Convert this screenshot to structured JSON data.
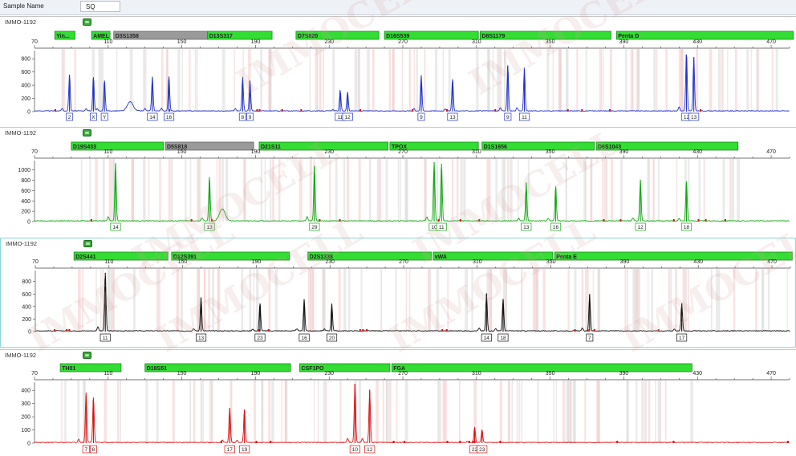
{
  "header": {
    "sample_name_label": "Sample Name",
    "sample_name_value": "SQ"
  },
  "watermark": {
    "text": "IMMOCELL",
    "color": "#d8a7a7"
  },
  "colors": {
    "blue": "#2233cc",
    "green": "#11aa11",
    "black": "#111111",
    "red": "#dd1111",
    "marker_fill": "#33dd33",
    "marker_gray": "#9a9a9a",
    "stutter": "#f3caca",
    "bin_gray": "#d9d9d9"
  },
  "chart_data": [
    {
      "type": "line",
      "panel_title": "IMMO-1192",
      "color": "blue",
      "xlim": [
        70,
        480
      ],
      "xticks": [
        70,
        110,
        150,
        190,
        230,
        270,
        310,
        350,
        390,
        430,
        470
      ],
      "ylim": [
        0,
        900
      ],
      "yticks": [
        0,
        200,
        400,
        600,
        800
      ],
      "markers": [
        {
          "label": "Yin...",
          "start": 81,
          "end": 92,
          "gray": false
        },
        {
          "label": "AMEL",
          "start": 101,
          "end": 111,
          "gray": false
        },
        {
          "label": "D3S1358",
          "start": 113,
          "end": 164,
          "gray": true
        },
        {
          "label": "D13S317",
          "start": 164,
          "end": 199,
          "gray": false
        },
        {
          "label": "D7S820",
          "start": 212,
          "end": 257,
          "gray": false
        },
        {
          "label": "D16S539",
          "start": 260,
          "end": 311,
          "gray": false
        },
        {
          "label": "D8S1179",
          "start": 312,
          "end": 383,
          "gray": false
        },
        {
          "label": "Penta D",
          "start": 386,
          "end": 482,
          "gray": false
        }
      ],
      "peaks": [
        {
          "x": 89,
          "h": 560,
          "label": "2"
        },
        {
          "x": 102,
          "h": 520,
          "label": "X"
        },
        {
          "x": 108,
          "h": 470,
          "label": "Y"
        },
        {
          "x": 134,
          "h": 520,
          "label": "14"
        },
        {
          "x": 143,
          "h": 530,
          "label": "16"
        },
        {
          "x": 183,
          "h": 490,
          "label": "8"
        },
        {
          "x": 187,
          "h": 470,
          "label": "9"
        },
        {
          "x": 236,
          "h": 300,
          "label": "11"
        },
        {
          "x": 240,
          "h": 290,
          "label": "12"
        },
        {
          "x": 280,
          "h": 540,
          "label": "9"
        },
        {
          "x": 297,
          "h": 490,
          "label": "13"
        },
        {
          "x": 327,
          "h": 700,
          "label": "9"
        },
        {
          "x": 336,
          "h": 660,
          "label": "11"
        },
        {
          "x": 424,
          "h": 860,
          "label": "12"
        },
        {
          "x": 428,
          "h": 820,
          "label": "13"
        }
      ],
      "minor_peaks": [
        {
          "x": 122,
          "h": 140
        }
      ]
    },
    {
      "type": "line",
      "panel_title": "IMMO-1192",
      "color": "green",
      "xlim": [
        70,
        480
      ],
      "xticks": [
        70,
        110,
        150,
        190,
        230,
        270,
        310,
        350,
        390,
        430,
        470
      ],
      "ylim": [
        0,
        1150
      ],
      "yticks": [
        0,
        200,
        400,
        600,
        800,
        1000
      ],
      "markers": [
        {
          "label": "D19S433",
          "start": 90,
          "end": 140,
          "gray": false
        },
        {
          "label": "D5S818",
          "start": 141,
          "end": 189,
          "gray": true
        },
        {
          "label": "D21S11",
          "start": 192,
          "end": 262,
          "gray": false
        },
        {
          "label": "TPOX",
          "start": 263,
          "end": 311,
          "gray": false
        },
        {
          "label": "D1S1656",
          "start": 313,
          "end": 374,
          "gray": false
        },
        {
          "label": "D6S1043",
          "start": 375,
          "end": 452,
          "gray": false
        }
      ],
      "peaks": [
        {
          "x": 114,
          "h": 1130,
          "label": "14"
        },
        {
          "x": 165,
          "h": 860,
          "label": "13"
        },
        {
          "x": 222,
          "h": 1080,
          "label": "29"
        },
        {
          "x": 287,
          "h": 1150,
          "label": "10"
        },
        {
          "x": 291,
          "h": 1120,
          "label": "11"
        },
        {
          "x": 337,
          "h": 750,
          "label": "13"
        },
        {
          "x": 353,
          "h": 680,
          "label": "16"
        },
        {
          "x": 399,
          "h": 800,
          "label": "12"
        },
        {
          "x": 424,
          "h": 780,
          "label": "18"
        }
      ],
      "minor_peaks": [
        {
          "x": 172,
          "h": 230
        }
      ]
    },
    {
      "type": "line",
      "panel_title": "IMMO-1192",
      "color": "black",
      "xlim": [
        70,
        480
      ],
      "xticks": [
        70,
        110,
        150,
        190,
        230,
        270,
        310,
        350,
        390,
        430,
        470
      ],
      "ylim": [
        0,
        950
      ],
      "yticks": [
        0,
        200,
        400,
        600,
        800
      ],
      "markers": [
        {
          "label": "D2S441",
          "start": 91,
          "end": 142,
          "gray": false
        },
        {
          "label": "D12S391",
          "start": 144,
          "end": 208,
          "gray": false
        },
        {
          "label": "D2S1338",
          "start": 218,
          "end": 285,
          "gray": false
        },
        {
          "label": "vWA",
          "start": 286,
          "end": 351,
          "gray": false
        },
        {
          "label": "Penta E",
          "start": 352,
          "end": 481,
          "gray": false
        }
      ],
      "peaks": [
        {
          "x": 108,
          "h": 940,
          "label": "11"
        },
        {
          "x": 160,
          "h": 540,
          "label": "13"
        },
        {
          "x": 192,
          "h": 450,
          "label": "23"
        },
        {
          "x": 216,
          "h": 510,
          "label": "16"
        },
        {
          "x": 231,
          "h": 440,
          "label": "20"
        },
        {
          "x": 315,
          "h": 600,
          "label": "14"
        },
        {
          "x": 324,
          "h": 520,
          "label": "18"
        },
        {
          "x": 371,
          "h": 590,
          "label": "7"
        },
        {
          "x": 421,
          "h": 450,
          "label": "17"
        }
      ],
      "minor_peaks": []
    },
    {
      "type": "line",
      "panel_title": "IMMO-1192",
      "color": "red",
      "xlim": [
        70,
        480
      ],
      "xticks": [
        70,
        110,
        150,
        190,
        230,
        270,
        310,
        350,
        390,
        430,
        470
      ],
      "ylim": [
        0,
        450
      ],
      "yticks": [
        0,
        100,
        200,
        300,
        400
      ],
      "markers": [
        {
          "label": "TH01",
          "start": 84,
          "end": 117,
          "gray": false
        },
        {
          "label": "D18S51",
          "start": 130,
          "end": 209,
          "gray": false
        },
        {
          "label": "CSF1PO",
          "start": 214,
          "end": 263,
          "gray": false
        },
        {
          "label": "FGA",
          "start": 264,
          "end": 427,
          "gray": false
        }
      ],
      "peaks": [
        {
          "x": 98,
          "h": 355,
          "label": "7"
        },
        {
          "x": 102,
          "h": 345,
          "label": "8"
        },
        {
          "x": 176,
          "h": 265,
          "label": "17"
        },
        {
          "x": 184,
          "h": 255,
          "label": "19"
        },
        {
          "x": 244,
          "h": 450,
          "label": "10"
        },
        {
          "x": 252,
          "h": 400,
          "label": "12"
        },
        {
          "x": 309,
          "h": 110,
          "label": "22"
        },
        {
          "x": 313,
          "h": 100,
          "label": "23"
        }
      ],
      "minor_peaks": []
    }
  ]
}
